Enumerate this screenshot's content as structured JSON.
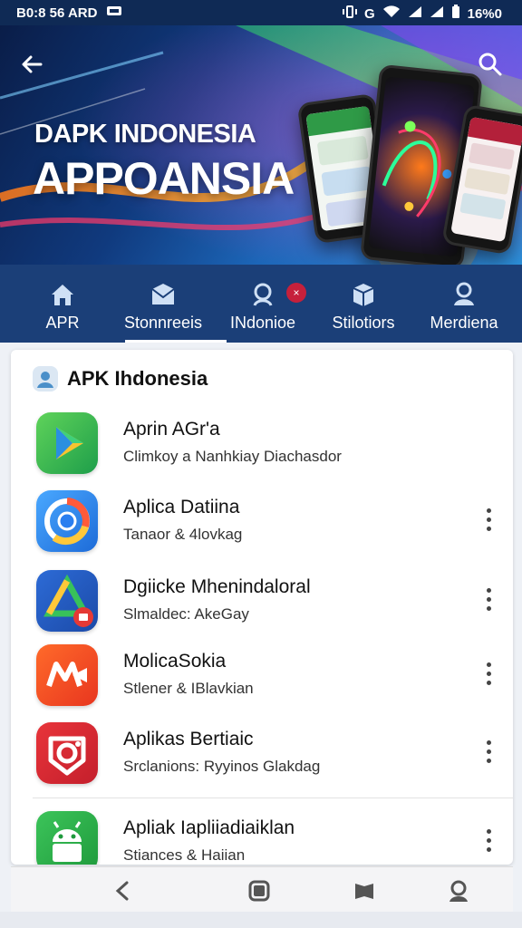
{
  "status_bar": {
    "time": "B0:8 56 ARD",
    "battery": "16%0",
    "carrier_glyph": "G"
  },
  "hero": {
    "subtitle": "DAPK INDONESIA",
    "title": "APPOANSIA",
    "back_icon": "arrow-left-icon",
    "search_icon": "search-icon"
  },
  "nav": {
    "items": [
      {
        "label": "APR",
        "icon": "home-icon"
      },
      {
        "label": "Stonnreeis",
        "icon": "envelope-icon"
      },
      {
        "label": "INdonioe",
        "icon": "search-icon"
      },
      {
        "label": "Stilotiors",
        "icon": "box-icon"
      },
      {
        "label": "Merdiena",
        "icon": "user-icon"
      }
    ],
    "active_index": 1,
    "badge_text": "×"
  },
  "list": {
    "header": "APK Ihdonesia",
    "apps": [
      {
        "name": "Aprin AGr'a",
        "subtitle": "Climkoy a Nanhkiay Diachasdor"
      },
      {
        "name": "Aplica Datiina",
        "subtitle": "Tanaor & 4lovkag"
      },
      {
        "name": "Dgiicke Mhenindaloral",
        "subtitle": "Slmaldec: AkeGay"
      },
      {
        "name": "MolicaSokia",
        "subtitle": "Stlener & IBlavkian"
      },
      {
        "name": "Aplikas Bertiaic",
        "subtitle": "Srclanions: Ryyinos Glakdag"
      },
      {
        "name": "Apliak Iapliiadiaiklan",
        "subtitle": "Stiances & Haiian"
      }
    ]
  },
  "colors": {
    "nav_bg": "#1b3f78",
    "status_bg": "#0f2a55",
    "badge": "#c6203b"
  }
}
